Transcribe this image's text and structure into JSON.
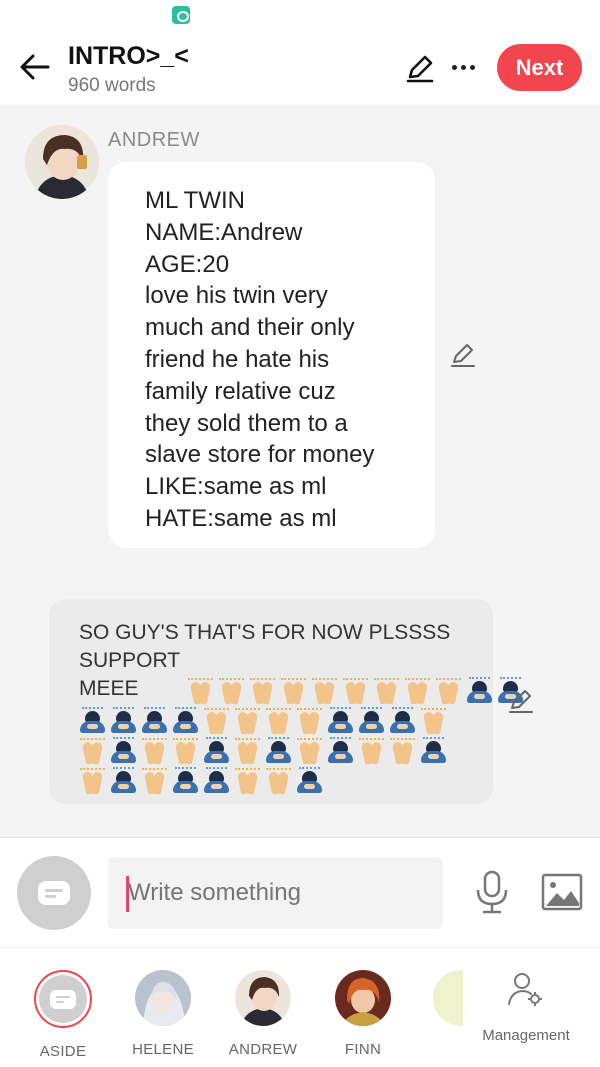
{
  "header": {
    "title": "INTRO>_<",
    "word_count": "960 words",
    "next_label": "Next",
    "accent_color": "#f2454d"
  },
  "messages": [
    {
      "speaker": "ANDREW",
      "lines": [
        "ML TWIN",
        "NAME:Andrew",
        "AGE:20",
        "love his twin very",
        "much and their only",
        "friend he hate his",
        "family relative cuz",
        "they sold them to a",
        "slave store for money",
        "LIKE:same as ml",
        "HATE:same as ml"
      ]
    },
    {
      "speaker": "ASIDE",
      "lines": [
        " SO GUY'S THAT'S FOR NOW PLSSSS",
        "SUPPORT",
        "MEEE"
      ],
      "emojis": [
        "pray",
        "pray",
        "pray",
        "pray",
        "pray",
        "pray",
        "pray",
        "pray",
        "pray",
        "bow",
        "bow",
        "bow",
        "bow",
        "bow",
        "bow",
        "pray",
        "pray",
        "pray",
        "pray",
        "bow",
        "bow",
        "bow",
        "pray",
        "pray",
        "bow",
        "pray",
        "pray",
        "bow",
        "pray",
        "bow",
        "pray",
        "bow",
        "pray",
        "pray",
        "bow",
        "pray",
        "bow",
        "pray",
        "bow",
        "bow",
        "pray",
        "pray",
        "bow"
      ]
    }
  ],
  "composer": {
    "placeholder": "Write something"
  },
  "characters": [
    {
      "name": "ASIDE"
    },
    {
      "name": "HELENE"
    },
    {
      "name": "ANDREW"
    },
    {
      "name": "FINN"
    },
    {
      "name": "."
    }
  ],
  "management_label": "Management",
  "icons": [
    "back-arrow-icon",
    "pencil-icon",
    "more-icon",
    "edit-icon",
    "message-icon",
    "mic-icon",
    "image-icon",
    "manage-users-icon",
    "pray-emoji",
    "bow-emoji"
  ]
}
